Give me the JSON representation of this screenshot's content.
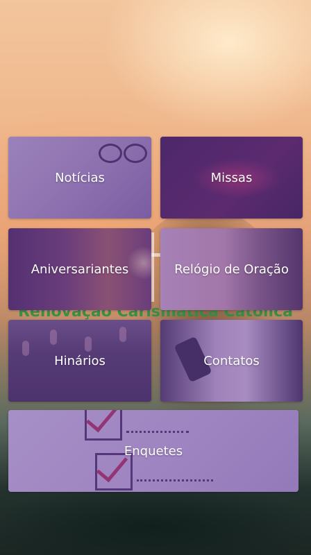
{
  "background": {
    "logo_text": "Renovação Carismática Católica"
  },
  "tiles": {
    "noticias": {
      "label": "Notícias",
      "icon": "newspaper-glasses-photo"
    },
    "missas": {
      "label": "Missas",
      "icon": "hands-photo"
    },
    "aniversariantes": {
      "label": "Aniversariantes",
      "icon": "sparkler-photo"
    },
    "relogio": {
      "label": "Relógio de Oração",
      "icon": "praying-woman-photo"
    },
    "hinarios": {
      "label": "Hinários",
      "icon": "worship-crowd-photo"
    },
    "contatos": {
      "label": "Contatos",
      "icon": "phone-photo"
    },
    "enquetes": {
      "label": "Enquetes",
      "icon": "checkbox-survey-photo"
    }
  },
  "colors": {
    "tile_tint": "#6a40a0",
    "logo_green": "#2f8d43"
  }
}
